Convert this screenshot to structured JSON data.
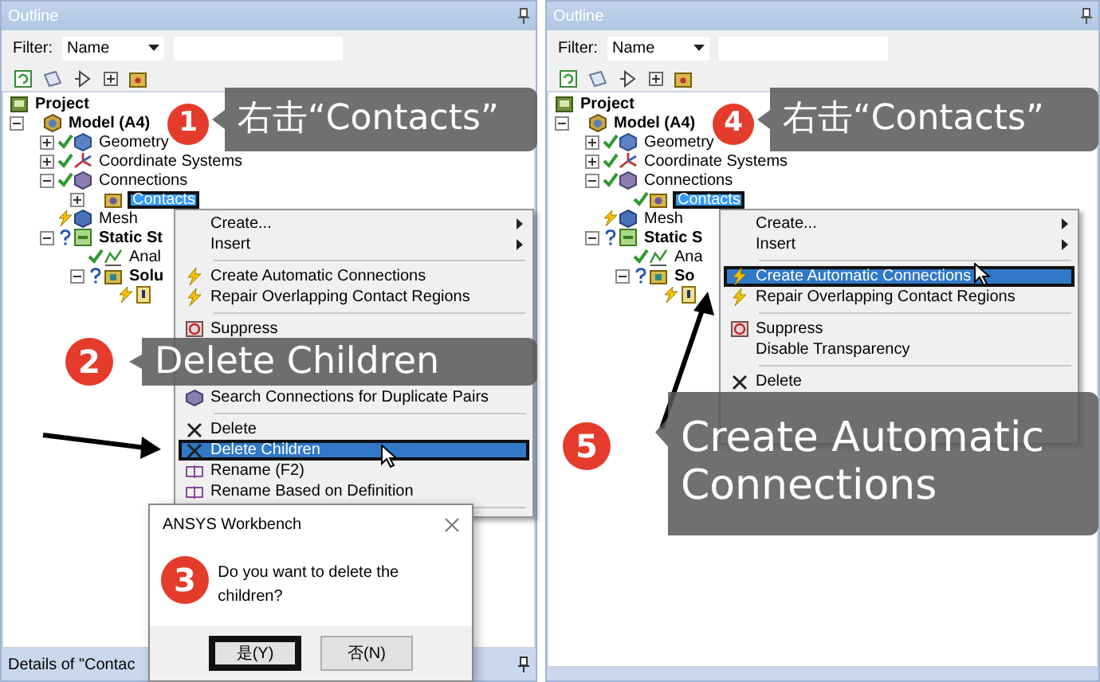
{
  "panels": [
    {
      "title": "Outline",
      "filter_label": "Filter:",
      "filter_value": "Name",
      "tree": [
        {
          "label": "Project",
          "kind": "project",
          "selected": false,
          "boxed": false,
          "children": [
            {
              "label": "Model (A4)",
              "kind": "model",
              "expanded": true,
              "selected": false,
              "boxed": false,
              "children": [
                {
                  "label": "Geometry",
                  "kind": "geometry",
                  "expanded": false,
                  "status": {
                    "kind": "check"
                  },
                  "selected": false,
                  "boxed": false
                },
                {
                  "label": "Coordinate Systems",
                  "kind": "coordinates",
                  "expanded": false,
                  "status": {
                    "kind": "check"
                  },
                  "selected": false,
                  "boxed": false
                },
                {
                  "label": "Connections",
                  "kind": "connections",
                  "expanded": true,
                  "status": {
                    "kind": "check"
                  },
                  "selected": false,
                  "boxed": false,
                  "children": [
                    {
                      "label": "Contacts",
                      "kind": "contacts",
                      "expanded": false,
                      "selected": true,
                      "boxed": true
                    }
                  ]
                },
                {
                  "label": "Mesh",
                  "kind": "mesh",
                  "status": {
                    "kind": "lightning"
                  },
                  "selected": false,
                  "boxed": false
                },
                {
                  "label": "Static St",
                  "kind": "environment",
                  "expanded": true,
                  "status": {
                    "kind": "question"
                  },
                  "selected": false,
                  "boxed": false,
                  "children": [
                    {
                      "label": "Anal",
                      "kind": "analysis",
                      "status": {
                        "kind": "check"
                      },
                      "selected": false,
                      "boxed": false
                    },
                    {
                      "label": "Solu",
                      "kind": "solution",
                      "expanded": true,
                      "status": {
                        "kind": "question"
                      },
                      "selected": false,
                      "boxed": false,
                      "children": [
                        {
                          "kind": "solution_info",
                          "status": {
                            "kind": "lightning"
                          }
                        }
                      ]
                    }
                  ]
                }
              ]
            }
          ]
        }
      ],
      "context_menu": [
        {
          "kind": "submenu",
          "label": "Create...",
          "selected": false,
          "boxed": false
        },
        {
          "kind": "submenu",
          "label": "Insert",
          "selected": false,
          "boxed": false
        },
        {
          "kind": "separator"
        },
        {
          "kind": "lightning",
          "label": "Create Automatic Connections",
          "selected": false,
          "boxed": false
        },
        {
          "kind": "lightning",
          "label": "Repair Overlapping Contact Regions",
          "selected": false,
          "boxed": false
        },
        {
          "kind": "separator"
        },
        {
          "kind": "suppress",
          "label": "Suppress",
          "selected": false,
          "boxed": false
        },
        {
          "kind": "covered"
        },
        {
          "kind": "search",
          "label": "Search Connections for Duplicate Pairs",
          "selected": false,
          "boxed": false
        },
        {
          "kind": "separator"
        },
        {
          "kind": "delete",
          "label": "Delete",
          "selected": false,
          "boxed": false
        },
        {
          "kind": "delete",
          "label": "Delete Children",
          "selected": true,
          "boxed": true
        },
        {
          "kind": "rename",
          "label": "Rename (F2)",
          "selected": false,
          "boxed": false
        },
        {
          "kind": "rename",
          "label": "Rename Based on Definition",
          "selected": false,
          "boxed": false
        },
        {
          "kind": "separator"
        }
      ],
      "callouts": [
        {
          "text": "右击“Contacts”"
        },
        {
          "text": "Delete Children"
        }
      ],
      "badges": [
        {
          "number": "1"
        },
        {
          "number": "2"
        },
        {
          "number": "3"
        }
      ],
      "dialog": {
        "title": "ANSYS Workbench",
        "message": "Do you want to delete the children?",
        "buttons": [
          {
            "label": "是(Y)",
            "boxed": true
          },
          {
            "label": "否(N)",
            "boxed": false
          }
        ]
      },
      "details_title": "Details of \"Contac"
    },
    {
      "title": "Outline",
      "filter_label": "Filter:",
      "filter_value": "Name",
      "tree": [
        {
          "label": "Project",
          "kind": "project",
          "selected": false,
          "boxed": false,
          "children": [
            {
              "label": "Model (A4)",
              "kind": "model",
              "expanded": true,
              "selected": false,
              "boxed": false,
              "children": [
                {
                  "label": "Geometry",
                  "kind": "geometry",
                  "expanded": false,
                  "status": {
                    "kind": "check"
                  },
                  "selected": false,
                  "boxed": false
                },
                {
                  "label": "Coordinate Systems",
                  "kind": "coordinates",
                  "expanded": false,
                  "status": {
                    "kind": "check"
                  },
                  "selected": false,
                  "boxed": false
                },
                {
                  "label": "Connections",
                  "kind": "connections",
                  "expanded": true,
                  "status": {
                    "kind": "check"
                  },
                  "selected": false,
                  "boxed": false,
                  "children": [
                    {
                      "label": "Contacts",
                      "kind": "contacts",
                      "status": {
                        "kind": "check"
                      },
                      "selected": true,
                      "boxed": true
                    }
                  ]
                },
                {
                  "label": "Mesh",
                  "kind": "mesh",
                  "status": {
                    "kind": "lightning"
                  },
                  "selected": false,
                  "boxed": false
                },
                {
                  "label": "Static S",
                  "kind": "environment",
                  "expanded": true,
                  "status": {
                    "kind": "question"
                  },
                  "selected": false,
                  "boxed": false,
                  "children": [
                    {
                      "label": "Ana",
                      "kind": "analysis",
                      "status": {
                        "kind": "check"
                      },
                      "selected": false,
                      "boxed": false
                    },
                    {
                      "label": "So",
                      "kind": "solution",
                      "expanded": true,
                      "status": {
                        "kind": "question"
                      },
                      "selected": false,
                      "boxed": false,
                      "children": [
                        {
                          "kind": "solution_info",
                          "status": {
                            "kind": "lightning"
                          }
                        }
                      ]
                    }
                  ]
                }
              ]
            }
          ]
        }
      ],
      "context_menu": [
        {
          "kind": "submenu",
          "label": "Create...",
          "selected": false,
          "boxed": false
        },
        {
          "kind": "submenu",
          "label": "Insert",
          "selected": false,
          "boxed": false
        },
        {
          "kind": "separator"
        },
        {
          "kind": "lightning",
          "label": "Create Automatic Connections",
          "selected": true,
          "boxed": true
        },
        {
          "kind": "lightning",
          "label": "Repair Overlapping Contact Regions",
          "selected": false,
          "boxed": false
        },
        {
          "kind": "separator"
        },
        {
          "kind": "suppress",
          "label": "Suppress",
          "selected": false,
          "boxed": false
        },
        {
          "kind": "plain",
          "label": "Disable Transparency",
          "selected": false,
          "boxed": false
        },
        {
          "kind": "separator"
        },
        {
          "kind": "delete",
          "label": "Delete",
          "selected": false,
          "boxed": false
        },
        {
          "kind": "covered"
        }
      ],
      "callouts": [
        {
          "text": "右击“Contacts”"
        },
        {
          "text": "Create Automatic Connections"
        }
      ],
      "badges": [
        {
          "number": "4"
        },
        {
          "number": "5"
        }
      ]
    }
  ]
}
